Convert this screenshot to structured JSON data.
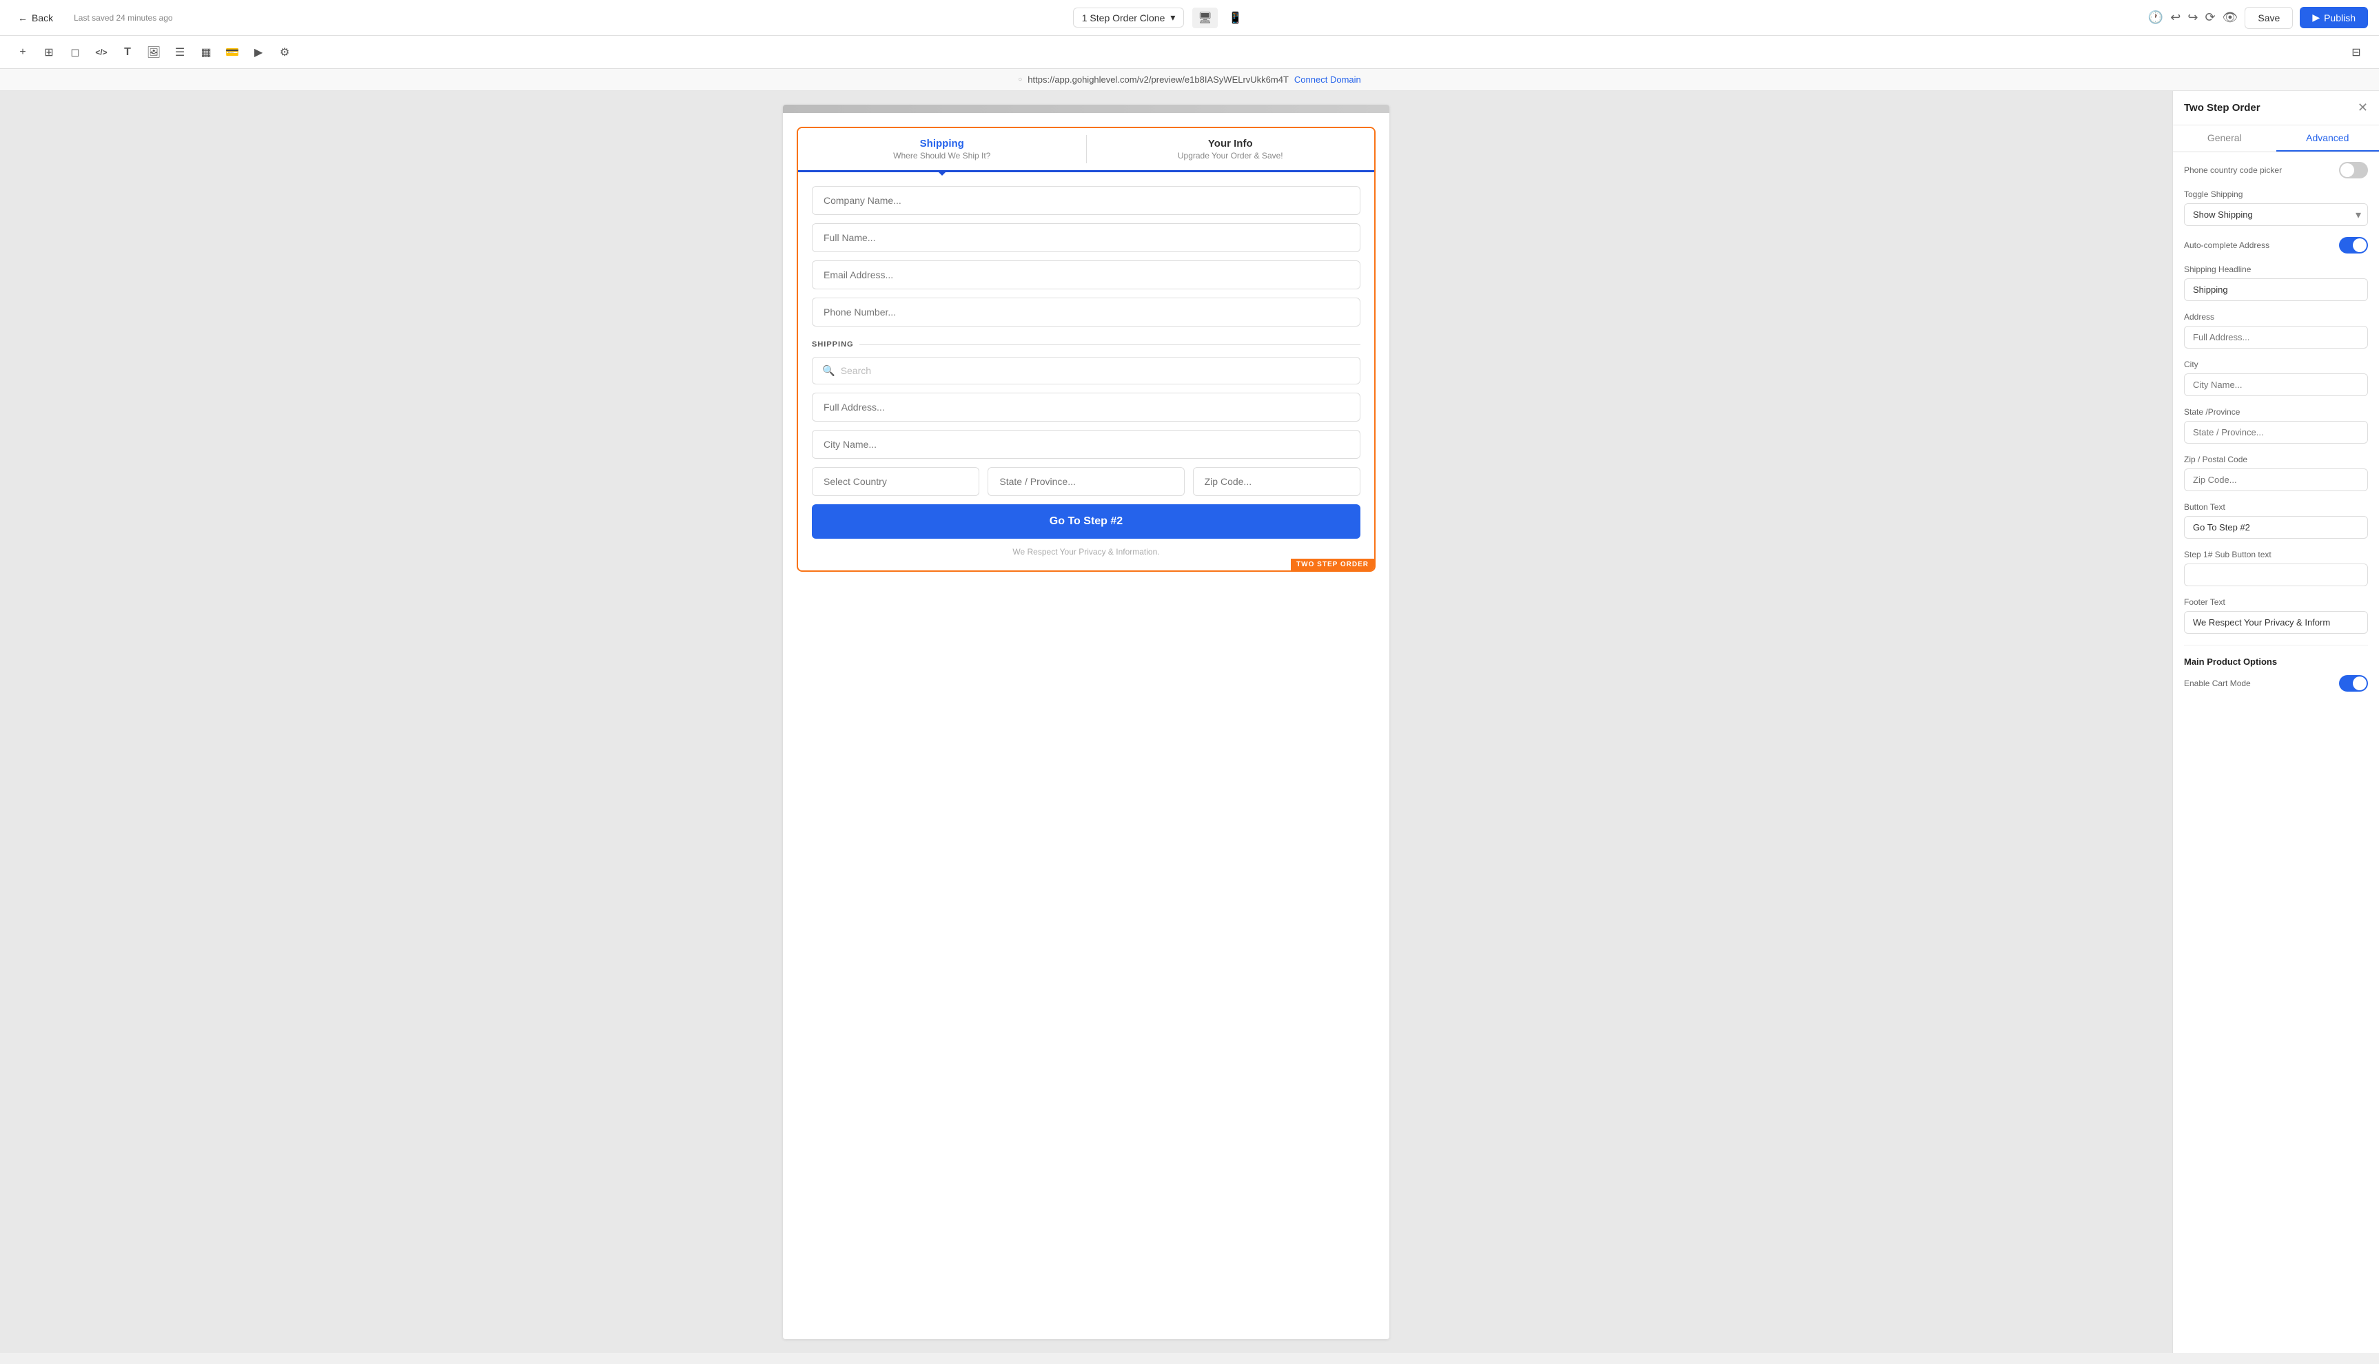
{
  "topNav": {
    "back_label": "Back",
    "saved_text": "Last saved 24 minutes ago",
    "page_name": "1 Step Order Clone",
    "save_label": "Save",
    "publish_label": "Publish"
  },
  "urlBar": {
    "url": "https://app.gohighlevel.com/v2/preview/e1b8IASyWELrvUkk6m4T",
    "connect_domain": "Connect Domain"
  },
  "toolbar": {
    "icons": [
      {
        "name": "plus-icon",
        "symbol": "+"
      },
      {
        "name": "layers-icon",
        "symbol": "⊞"
      },
      {
        "name": "page-icon",
        "symbol": "◻"
      },
      {
        "name": "code-icon",
        "symbol": "</>"
      },
      {
        "name": "text-icon",
        "symbol": "T"
      },
      {
        "name": "image-icon",
        "symbol": "🖼"
      },
      {
        "name": "shape-icon",
        "symbol": "◯"
      },
      {
        "name": "layout-icon",
        "symbol": "▦"
      },
      {
        "name": "payment-icon",
        "symbol": "💳"
      },
      {
        "name": "media-icon",
        "symbol": "▶"
      },
      {
        "name": "apps-icon",
        "symbol": "⚙"
      }
    ],
    "panel_toggle": "⊟"
  },
  "orderForm": {
    "step1_title": "Shipping",
    "step1_sub": "Where Should We Ship It?",
    "step2_title": "Your Info",
    "step2_sub": "Upgrade Your Order & Save!",
    "fields": {
      "company": "Company Name...",
      "fullname": "Full Name...",
      "email": "Email Address...",
      "phone": "Phone Number..."
    },
    "shipping_label": "SHIPPING",
    "search_placeholder": "Search",
    "address": "Full Address...",
    "city": "City Name...",
    "country": "Select Country",
    "state": "State / Province...",
    "zip": "Zip Code...",
    "button_text": "Go To Step #2",
    "footer_text": "We Respect Your Privacy & Information.",
    "badge_text": "TWO STEP ORDER"
  },
  "rightPanel": {
    "title": "Two Step Order",
    "tabs": [
      {
        "label": "General",
        "active": false
      },
      {
        "label": "Advanced",
        "active": true
      }
    ],
    "phone_country_code": "Phone country code picker",
    "toggle_shipping_label": "Toggle Shipping",
    "toggle_shipping_value": "Show Shipping",
    "autocomplete_label": "Auto-complete Address",
    "autocomplete_on": true,
    "phone_country_on": false,
    "shipping_headline_label": "Shipping Headline",
    "shipping_headline_value": "Shipping",
    "address_label": "Address",
    "address_value": "Full Address...",
    "city_label": "City",
    "city_value": "City Name...",
    "state_label": "State /Province",
    "state_value": "State / Province...",
    "zip_label": "Zip / Postal Code",
    "zip_value": "Zip Code...",
    "button_text_label": "Button Text",
    "button_text_value": "Go To Step #2",
    "step1_sub_label": "Step 1# Sub Button text",
    "step1_sub_value": "",
    "footer_text_label": "Footer Text",
    "footer_text_value": "We Respect Your Privacy & Inform",
    "main_product_label": "Main Product Options",
    "enable_cart_label": "Enable Cart Mode",
    "enable_cart_on": true
  }
}
